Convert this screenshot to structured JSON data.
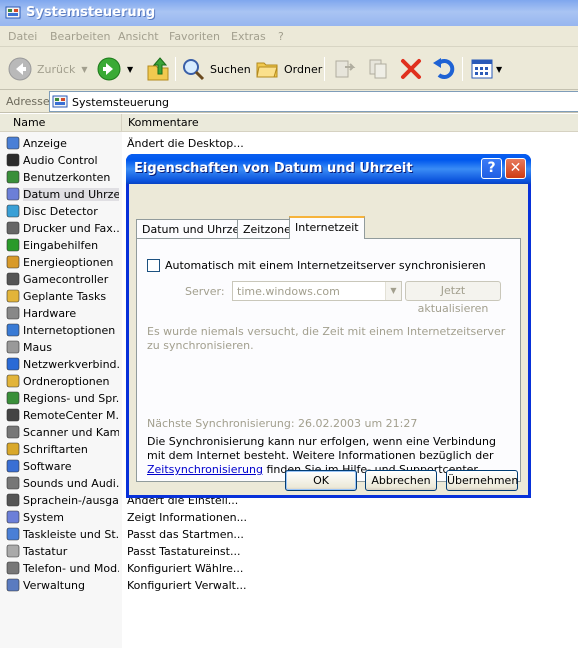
{
  "window": {
    "title": "Systemsteuerung"
  },
  "menu": [
    "Datei",
    "Bearbeiten",
    "Ansicht",
    "Favoriten",
    "Extras",
    "?"
  ],
  "toolbar": {
    "back_label": "Zurück",
    "search_label": "Suchen",
    "folders_label": "Ordner"
  },
  "address": {
    "label": "Adresse",
    "value": "Systemsteuerung"
  },
  "list": {
    "col_name": "Name",
    "col_comment": "Kommentare",
    "items": [
      {
        "name": "Anzeige",
        "desc": "Ändert die Desktop..."
      },
      {
        "name": "Audio Control",
        "desc": ""
      },
      {
        "name": "Benutzerkonten",
        "desc": ""
      },
      {
        "name": "Datum und Uhrzeit",
        "desc": ""
      },
      {
        "name": "Disc Detector",
        "desc": ""
      },
      {
        "name": "Drucker und Fax...",
        "desc": ""
      },
      {
        "name": "Eingabehilfen",
        "desc": ""
      },
      {
        "name": "Energieoptionen",
        "desc": ""
      },
      {
        "name": "Gamecontroller",
        "desc": ""
      },
      {
        "name": "Geplante Tasks",
        "desc": ""
      },
      {
        "name": "Hardware",
        "desc": ""
      },
      {
        "name": "Internetoptionen",
        "desc": ""
      },
      {
        "name": "Maus",
        "desc": ""
      },
      {
        "name": "Netzwerkverbind...",
        "desc": ""
      },
      {
        "name": "Ordneroptionen",
        "desc": ""
      },
      {
        "name": "Regions- und Spr...",
        "desc": ""
      },
      {
        "name": "RemoteCenter M...",
        "desc": ""
      },
      {
        "name": "Scanner und Kam...",
        "desc": ""
      },
      {
        "name": "Schriftarten",
        "desc": ""
      },
      {
        "name": "Software",
        "desc": ""
      },
      {
        "name": "Sounds und Audi...",
        "desc": ""
      },
      {
        "name": "Sprachein-/ausgabe",
        "desc": "Ändert die Einstell..."
      },
      {
        "name": "System",
        "desc": "Zeigt Informationen..."
      },
      {
        "name": "Taskleiste und St...",
        "desc": "Passt das Startmen..."
      },
      {
        "name": "Tastatur",
        "desc": "Passt Tastatureinst..."
      },
      {
        "name": "Telefon- und Mod...",
        "desc": "Konfiguriert Wählre..."
      },
      {
        "name": "Verwaltung",
        "desc": "Konfiguriert Verwalt..."
      }
    ]
  },
  "dialog": {
    "title": "Eigenschaften von Datum und Uhrzeit",
    "help_glyph": "?",
    "close_glyph": "✕",
    "tabs": [
      "Datum und Uhrzeit",
      "Zeitzone",
      "Internetzeit"
    ],
    "auto_sync_label": "Automatisch mit einem Internetzeitserver synchronisieren",
    "server_label": "Server:",
    "server_value": "time.windows.com",
    "update_button": "Jetzt aktualisieren",
    "status_text": "Es wurde niemals versucht, die Zeit mit einem Internetzeitserver zu synchronisieren.",
    "next_sync": "Nächste Synchronisierung: 26.02.2003 um 21:27",
    "info_text_before": "Die Synchronisierung kann nur erfolgen, wenn eine Verbindung mit dem Internet besteht. Weitere Informationen bezüglich der ",
    "info_link": "Zeitsynchronisierung",
    "info_text_after": " finden Sie im Hilfe- und Supportcenter.",
    "ok": "OK",
    "cancel": "Abbrechen",
    "apply": "Übernehmen"
  }
}
